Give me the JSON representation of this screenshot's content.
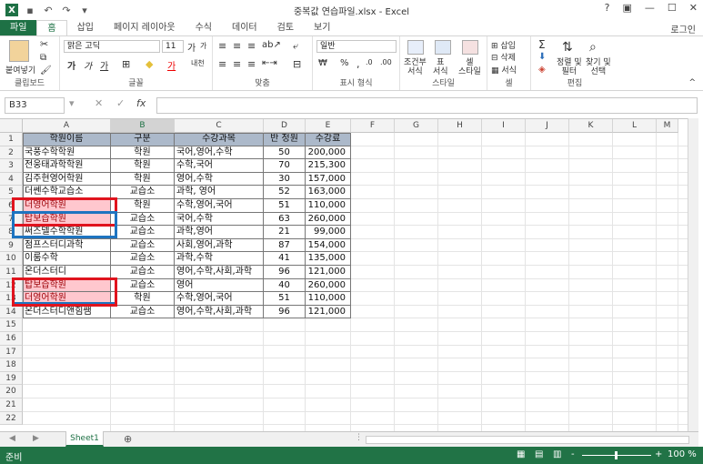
{
  "titlebar": {
    "title": "중복값 연습파일.xlsx - Excel",
    "help": "?",
    "login": "로그인"
  },
  "tabs": [
    "파일",
    "홈",
    "삽입",
    "페이지 레이아웃",
    "수식",
    "데이터",
    "검토",
    "보기"
  ],
  "ribbon": {
    "clipboard": {
      "paste": "붙여넣기",
      "label": "클립보드"
    },
    "font": {
      "name": "맑은 고딕",
      "size": "11",
      "label": "글꼴",
      "bold": "가",
      "italic": "가",
      "underline": "가",
      "grow": "가",
      "shrink": "가",
      "phon": "내천"
    },
    "align": {
      "label": "맞춤"
    },
    "number": {
      "format": "일반",
      "label": "표시 형식",
      "pct": "%",
      "comma": ","
    },
    "styles": {
      "cond": "조건부\n서식",
      "table": "표\n서식",
      "cell": "셀\n스타일",
      "label": "스타일"
    },
    "cells": {
      "insert": "삽입",
      "delete": "삭제",
      "format": "서식",
      "label": "셀"
    },
    "edit": {
      "sort": "정렬 및\n필터",
      "find": "찾기 및\n선택",
      "label": "편집"
    }
  },
  "formula": {
    "namebox": "B33",
    "fx": "fx",
    "cancel": "✕",
    "enter": "✓",
    "value": ""
  },
  "columns": [
    "A",
    "B",
    "C",
    "D",
    "E",
    "F",
    "G",
    "H",
    "I",
    "J",
    "K",
    "L",
    "M"
  ],
  "table": {
    "headers": [
      "학원이름",
      "구분",
      "수강과목",
      "반 정원",
      "수강료"
    ],
    "rows": [
      [
        "국풍수학학원",
        "학원",
        "국어,영어,수학",
        "50",
        "200,000"
      ],
      [
        "전웅태과학학원",
        "학원",
        "수학,국어",
        "70",
        "215,300"
      ],
      [
        "김주현영어학원",
        "학원",
        "영어,수학",
        "30",
        "157,000"
      ],
      [
        "더쎈수학교습소",
        "교습소",
        "과학, 영어",
        "52",
        "163,000"
      ],
      [
        "더영어학원",
        "학원",
        "수학,영어,국어",
        "51",
        "110,000"
      ],
      [
        "탑보습학원",
        "교습소",
        "국어,수학",
        "63",
        "260,000"
      ],
      [
        "써즈델수학학원",
        "교습소",
        "과학,영어",
        "21",
        "99,000"
      ],
      [
        "점프스터디과학",
        "교습소",
        "사회,영어,과학",
        "87",
        "154,000"
      ],
      [
        "이룸수학",
        "교습소",
        "과학,수학",
        "41",
        "135,000"
      ],
      [
        "온더스터디",
        "교습소",
        "영어,수학,사회,과학",
        "96",
        "121,000"
      ],
      [
        "탑보습학원",
        "교습소",
        "영어",
        "40",
        "260,000"
      ],
      [
        "더영어학원",
        "학원",
        "수학,영어,국어",
        "51",
        "110,000"
      ],
      [
        "온더스터디앤힘쌤",
        "교습소",
        "영어,수학,사회,과학",
        "96",
        "121,000"
      ]
    ]
  },
  "row_count": 22,
  "colors": {
    "excel_green": "#217346",
    "header_fill": "#acb9ca",
    "dup_fill": "#ffc7ce",
    "dup_text": "#9c0006",
    "red_box": "#e0141e",
    "blue_box": "#1e74c0"
  },
  "sheets": [
    "Sheet1"
  ],
  "status": {
    "ready": "준비",
    "zoom": "100 %",
    "minus": "-",
    "plus": "+"
  }
}
